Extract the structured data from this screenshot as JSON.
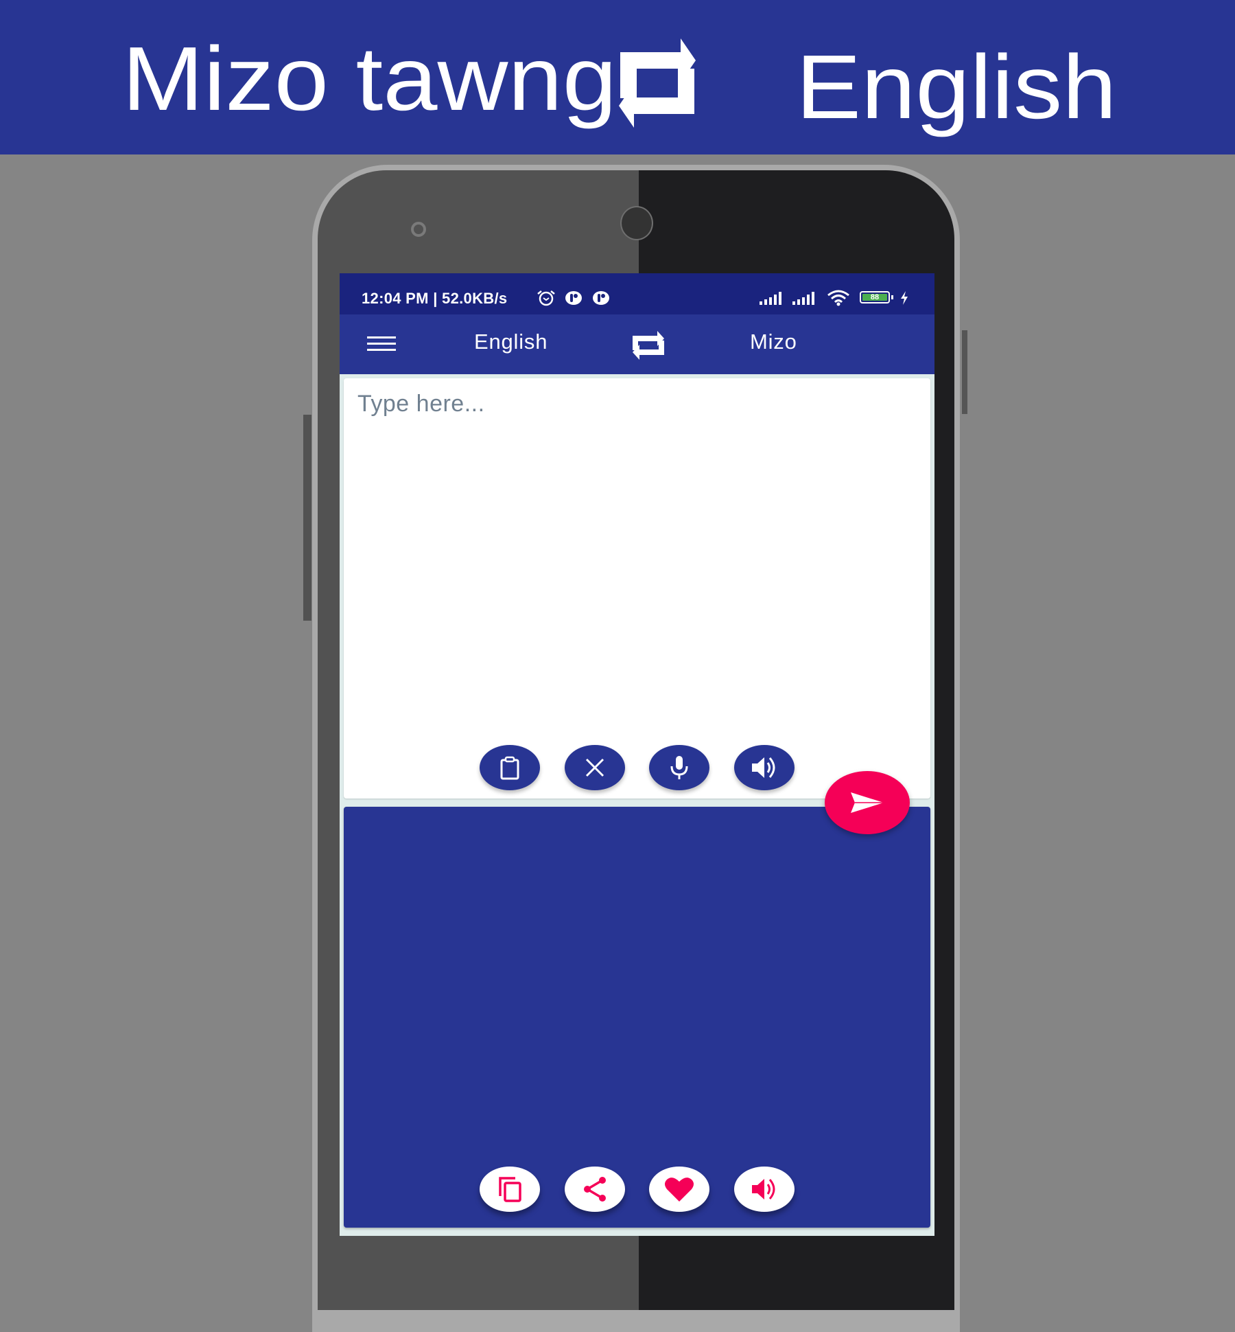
{
  "banner": {
    "source_language": "Mizo tawng",
    "target_language": "English",
    "swap_icon": "swap-arrows-icon"
  },
  "status_bar": {
    "time_and_speed": "12:04 PM | 52.0KB/s",
    "icons": [
      "alarm-icon",
      "notification-app-icon",
      "notification-app-icon",
      "signal-icon",
      "signal-icon",
      "wifi-icon",
      "battery-icon",
      "charging-icon"
    ],
    "battery_level": "88"
  },
  "app_bar": {
    "menu_icon": "hamburger-menu-icon",
    "from_language": "English",
    "to_language": "Mizo",
    "swap_icon": "swap-arrows-icon"
  },
  "input": {
    "placeholder": "Type here...",
    "value": "",
    "actions": [
      {
        "name": "paste",
        "icon": "clipboard-icon"
      },
      {
        "name": "clear",
        "icon": "close-icon"
      },
      {
        "name": "voice-input",
        "icon": "microphone-icon"
      },
      {
        "name": "speak-input",
        "icon": "speaker-icon"
      }
    ]
  },
  "send_button": {
    "icon": "send-icon"
  },
  "output": {
    "value": "",
    "actions": [
      {
        "name": "copy",
        "icon": "copy-icon"
      },
      {
        "name": "share",
        "icon": "share-icon"
      },
      {
        "name": "favorite",
        "icon": "heart-icon"
      },
      {
        "name": "speak-output",
        "icon": "speaker-icon"
      }
    ]
  },
  "colors": {
    "primary": "#283593",
    "primary_dark": "#1a237e",
    "accent": "#f50057",
    "background": "#858585"
  }
}
